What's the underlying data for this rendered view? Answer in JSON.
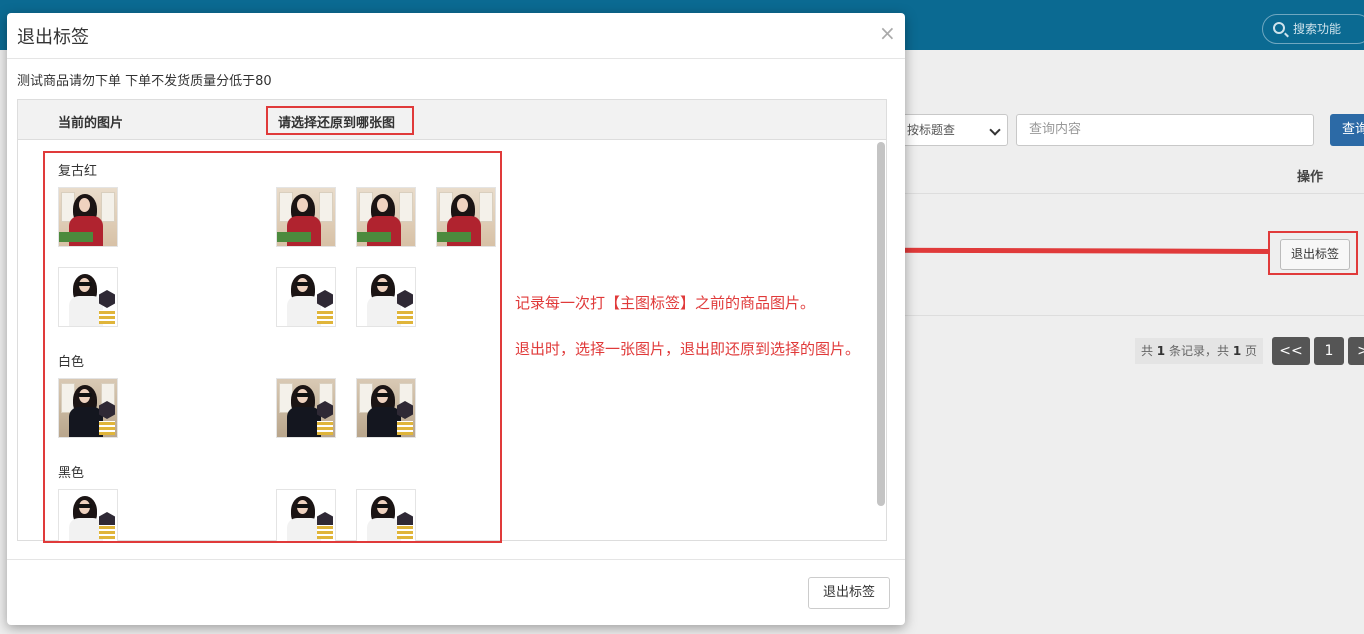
{
  "background_page": {
    "topbar_search_placeholder": "搜索功能",
    "filter_select_value": "按标题查",
    "query_placeholder": "查询内容",
    "query_button_label": "查询",
    "operations_column_header": "操作",
    "row_action_button_label": "退出标签",
    "pager": {
      "total_text_prefix": "共",
      "total_records": "1",
      "total_text_mid": "条记录，共",
      "total_pages": "1",
      "total_text_suffix": "页",
      "prev_label": "<<",
      "current_page": "1",
      "next_label": ">"
    }
  },
  "annotations": {
    "line1": "记录每一次打【主图标签】之前的商品图片。",
    "line2": "退出时，选择一张图片，退出即还原到选择的图片。"
  },
  "modal": {
    "title": "退出标签",
    "close_symbol": "×",
    "notice": "测试商品请勿下单 下单不发货质量分低于80",
    "columns": {
      "current_images": "当前的图片",
      "restore_to": "请选择还原到哪张图"
    },
    "groups": [
      {
        "label": "复古红"
      },
      {
        "label": "白色"
      },
      {
        "label": "黑色"
      }
    ],
    "footer_button_label": "退出标签"
  },
  "colors": {
    "annotation_red": "#e03a3a",
    "topbar_blue": "#0b6a92",
    "query_button_blue": "#2c6aa6",
    "pager_dark": "#555555"
  }
}
